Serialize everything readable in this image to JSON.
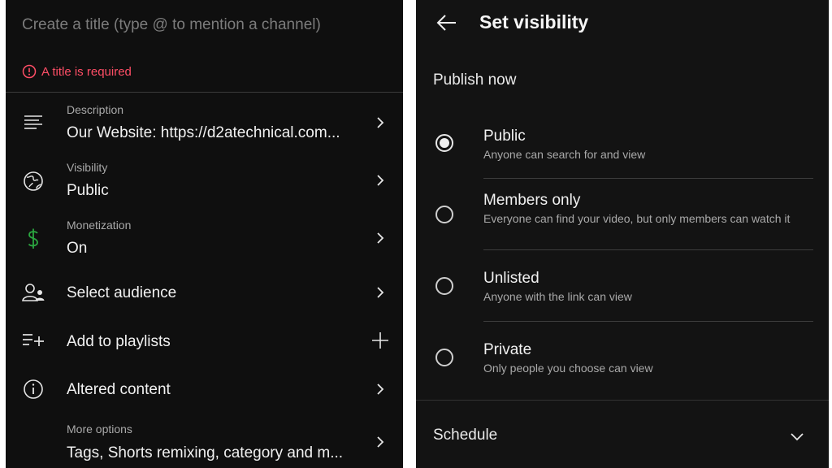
{
  "left": {
    "title_placeholder": "Create a title (type @ to mention a channel)",
    "error": "A title is required",
    "rows": [
      {
        "label": "Description",
        "value": "Our Website: https://d2atechnical.com..."
      },
      {
        "label": "Visibility",
        "value": "Public"
      },
      {
        "label": "Monetization",
        "value": "On"
      },
      {
        "label": "",
        "value": "Select audience"
      },
      {
        "label": "",
        "value": "Add to playlists"
      },
      {
        "label": "",
        "value": "Altered content"
      },
      {
        "label": "More options",
        "value": "Tags, Shorts remixing, category and m..."
      }
    ]
  },
  "right": {
    "title": "Set visibility",
    "publish_now": "Publish now",
    "options": [
      {
        "title": "Public",
        "desc": "Anyone can search for and view",
        "checked": true
      },
      {
        "title": "Members only",
        "desc": "Everyone can find your video, but only members can watch it",
        "checked": false
      },
      {
        "title": "Unlisted",
        "desc": "Anyone with the link can view",
        "checked": false
      },
      {
        "title": "Private",
        "desc": "Only people you choose can view",
        "checked": false
      }
    ],
    "schedule": "Schedule"
  },
  "colors": {
    "background": "#0f0f0f",
    "error": "#ff4e66",
    "monetization_icon": "#2ba640",
    "text_primary": "#f1f1f1",
    "text_secondary": "#a9a9a9"
  },
  "icons": [
    "error-circle-icon",
    "description-lines-icon",
    "globe-icon",
    "dollar-icon",
    "audience-icon",
    "playlist-add-icon",
    "info-icon",
    "chevron-right-icon",
    "plus-icon",
    "back-arrow-icon",
    "chevron-down-icon"
  ]
}
